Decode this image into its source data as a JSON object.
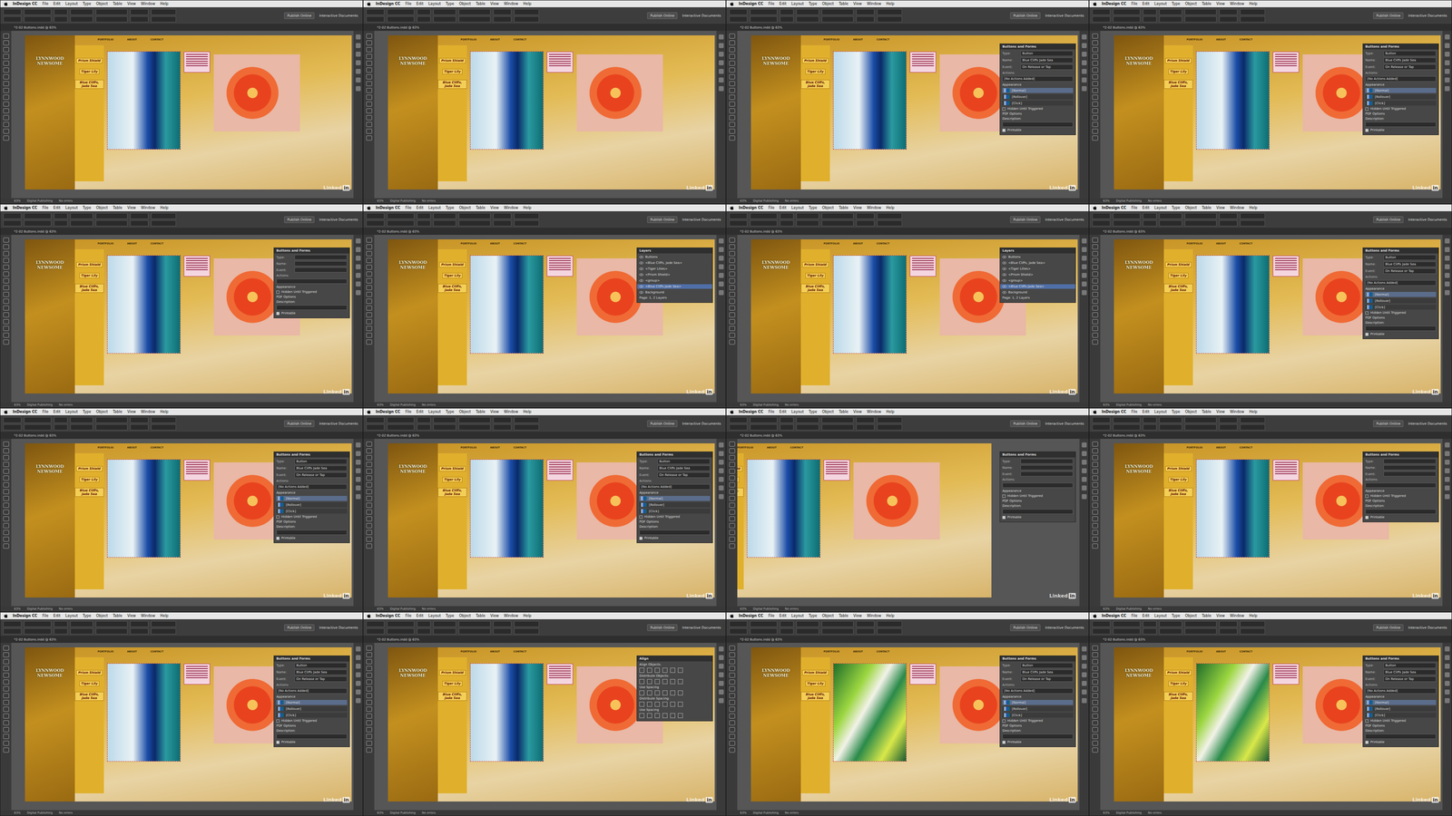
{
  "app": "InDesign CC",
  "menus": [
    "File",
    "Edit",
    "Layout",
    "Type",
    "Object",
    "Table",
    "View",
    "Window",
    "Help"
  ],
  "publish": "Publish Online",
  "workspace": "Interactive Documents",
  "doc_tab": "*2-02 Buttons.indd @ 63%",
  "zoom": "63%",
  "page": {
    "author": "LYNNWOOD NEWSOME",
    "nav": [
      "PORTFOLIO",
      "ABOUT",
      "CONTACT"
    ],
    "titles": [
      "Prism Shield",
      "Tiger Lily",
      "Blue Cliffs, Jade Sea"
    ]
  },
  "status": [
    "Digital Publishing",
    "No errors"
  ],
  "watermark": {
    "word": "Linked",
    "badge": "in"
  },
  "buttons_panel": {
    "title": "Buttons and Forms",
    "fields": [
      {
        "label": "Type:",
        "value": "Button"
      },
      {
        "label": "Name:",
        "value": "Blue Cliffs Jade Sea"
      },
      {
        "label": "Event:",
        "value": "On Release or Tap"
      }
    ],
    "actions_label": "Actions:",
    "no_actions": "[No Actions Added]",
    "appearance": "Appearance",
    "states": [
      {
        "label": "[Normal]",
        "selected": true
      },
      {
        "label": "[Rollover]",
        "selected": false
      },
      {
        "label": "[Click]",
        "selected": false
      }
    ],
    "hidden": "Hidden Until Triggered",
    "pdf": "PDF Options",
    "description": "Description:",
    "printable": "Printable",
    "printable_checked": true
  },
  "layers_panel": {
    "title": "Layers",
    "items": [
      {
        "label": "Buttons",
        "selected": false
      },
      {
        "label": "<Blue Cliffs, Jade Sea>",
        "selected": false
      },
      {
        "label": "<Tiger Lilies>",
        "selected": false
      },
      {
        "label": "<Prism Shield>",
        "selected": false
      },
      {
        "label": "<group>",
        "selected": false
      },
      {
        "label": "<Blue Cliffs Jade Sea>",
        "selected": true
      },
      {
        "label": "Background",
        "selected": false
      }
    ],
    "footer": "Page: 1, 2 Layers"
  },
  "align_panel": {
    "title": "Align",
    "sections": [
      "Align Objects:",
      "Distribute Objects:",
      "Use Spacing",
      "Distribute Spacing:",
      "Use Spacing"
    ]
  },
  "tiles": [
    {
      "panel": "none",
      "view": "normal"
    },
    {
      "panel": "none",
      "view": "normal"
    },
    {
      "panel": "buttons",
      "view": "normal"
    },
    {
      "panel": "buttons",
      "view": "normal"
    },
    {
      "panel": "buttons-empty",
      "view": "normal"
    },
    {
      "panel": "layers",
      "view": "normal"
    },
    {
      "panel": "layers",
      "view": "normal"
    },
    {
      "panel": "buttons",
      "view": "normal"
    },
    {
      "panel": "buttons",
      "view": "normal"
    },
    {
      "panel": "buttons",
      "view": "normal"
    },
    {
      "panel": "buttons-empty",
      "view": "scrolled"
    },
    {
      "panel": "buttons-empty",
      "view": "normal"
    },
    {
      "panel": "buttons",
      "view": "normal"
    },
    {
      "panel": "align",
      "view": "normal"
    },
    {
      "panel": "buttons",
      "view": "green"
    },
    {
      "panel": "buttons",
      "view": "green"
    }
  ]
}
